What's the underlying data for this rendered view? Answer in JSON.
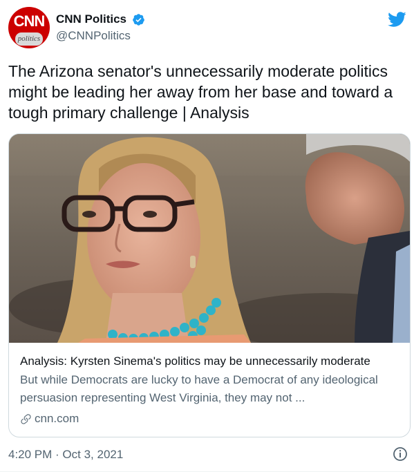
{
  "account": {
    "display_name": "CNN Politics",
    "handle": "@CNNPolitics",
    "avatar_logo": "CNN",
    "avatar_sub": "politics"
  },
  "tweet": {
    "text": "The Arizona senator's unnecessarily moderate politics might be leading her away from her base and toward a tough primary challenge | Analysis",
    "timestamp": "4:20 PM · Oct 3, 2021"
  },
  "card": {
    "title": "Analysis: Kyrsten Sinema's politics may be unnecessarily moderate",
    "description": "But while Democrats are lucky to have a Democrat of any ideological persuasion representing West Virginia, they may not ...",
    "domain": "cnn.com"
  },
  "icons": {
    "verified": "verified-badge-icon",
    "brand": "twitter-bird-icon",
    "link": "link-icon",
    "info": "info-icon"
  },
  "colors": {
    "accent": "#1d9bf0",
    "text_primary": "#0f1419",
    "text_secondary": "#536471",
    "border": "#cfd9de",
    "cnn_red": "#cc0000"
  }
}
